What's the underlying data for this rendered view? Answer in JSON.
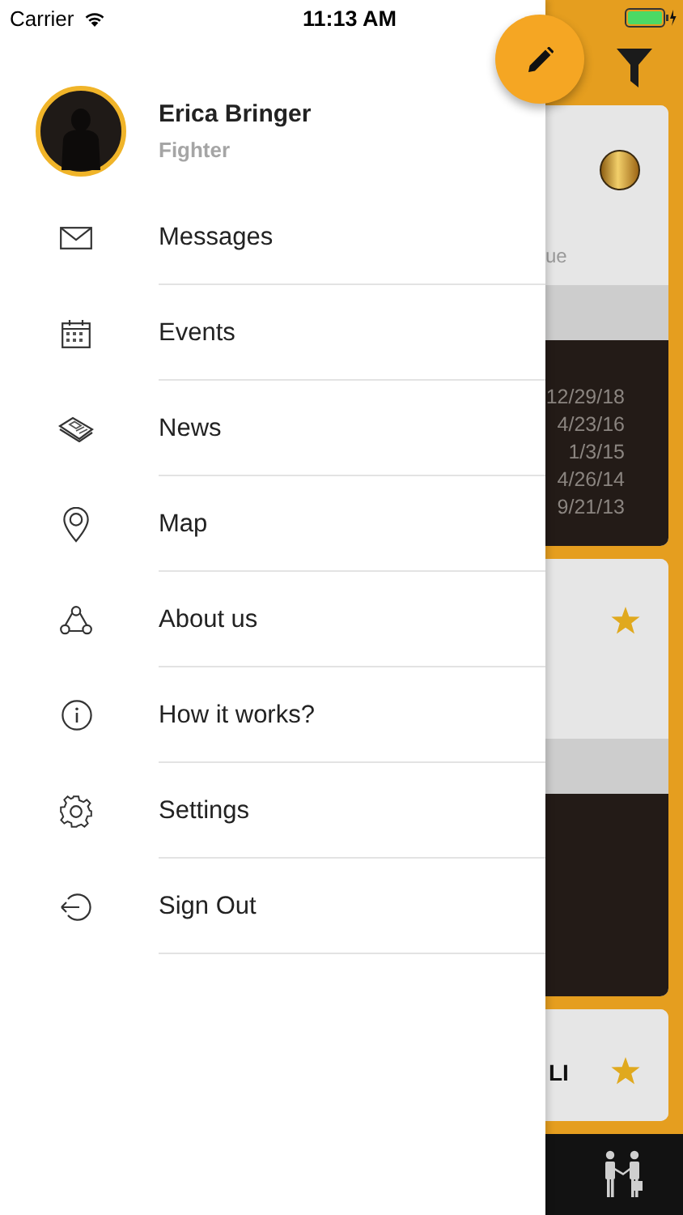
{
  "status_bar": {
    "carrier": "Carrier",
    "time": "11:13 AM"
  },
  "profile": {
    "name": "Erica Bringer",
    "role": "Fighter"
  },
  "menu": [
    {
      "label": "Messages",
      "kind": "mail"
    },
    {
      "label": "Events",
      "kind": "calendar"
    },
    {
      "label": "News",
      "kind": "newspaper"
    },
    {
      "label": "Map",
      "kind": "pin"
    },
    {
      "label": "About us",
      "kind": "group"
    },
    {
      "label": "How it works?",
      "kind": "info"
    },
    {
      "label": "Settings",
      "kind": "gear"
    },
    {
      "label": "Sign Out",
      "kind": "signout"
    }
  ],
  "background_cards": [
    {
      "kind": "medal",
      "caption": "ue",
      "dates": [
        "12/29/18",
        "4/23/16",
        "1/3/15",
        "4/26/14",
        "9/21/13"
      ]
    },
    {
      "kind": "star"
    },
    {
      "kind": "star",
      "title": "LI"
    }
  ]
}
